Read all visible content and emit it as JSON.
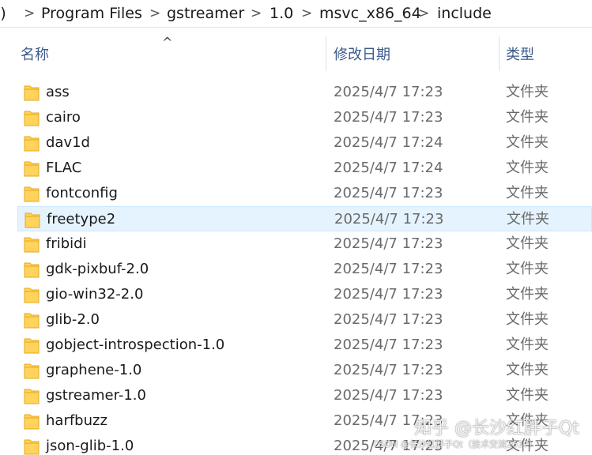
{
  "breadcrumb": {
    "items": [
      ":)",
      "Program Files",
      "gstreamer",
      "1.0",
      "msvc_x86_64",
      "include"
    ],
    "separator": ">"
  },
  "columns": {
    "name": "名称",
    "date": "修改日期",
    "type": "类型",
    "sort_indicator": "^"
  },
  "files": [
    {
      "name": "ass",
      "date": "2025/4/7 17:23",
      "type": "文件夹"
    },
    {
      "name": "cairo",
      "date": "2025/4/7 17:23",
      "type": "文件夹"
    },
    {
      "name": "dav1d",
      "date": "2025/4/7 17:24",
      "type": "文件夹"
    },
    {
      "name": "FLAC",
      "date": "2025/4/7 17:24",
      "type": "文件夹"
    },
    {
      "name": "fontconfig",
      "date": "2025/4/7 17:23",
      "type": "文件夹"
    },
    {
      "name": "freetype2",
      "date": "2025/4/7 17:23",
      "type": "文件夹",
      "selected": true
    },
    {
      "name": "fribidi",
      "date": "2025/4/7 17:23",
      "type": "文件夹"
    },
    {
      "name": "gdk-pixbuf-2.0",
      "date": "2025/4/7 17:23",
      "type": "文件夹"
    },
    {
      "name": "gio-win32-2.0",
      "date": "2025/4/7 17:23",
      "type": "文件夹"
    },
    {
      "name": "glib-2.0",
      "date": "2025/4/7 17:23",
      "type": "文件夹"
    },
    {
      "name": "gobject-introspection-1.0",
      "date": "2025/4/7 17:23",
      "type": "文件夹"
    },
    {
      "name": "graphene-1.0",
      "date": "2025/4/7 17:23",
      "type": "文件夹"
    },
    {
      "name": "gstreamer-1.0",
      "date": "2025/4/7 17:23",
      "type": "文件夹"
    },
    {
      "name": "harfbuzz",
      "date": "2025/4/7 17:23",
      "type": "文件夹"
    },
    {
      "name": "json-glib-1.0",
      "date": "2025/4/7 17:23",
      "type": "文件夹"
    }
  ],
  "watermark": {
    "main": "知乎 @长沙红胖子Qt",
    "sub": "CSDN @长沙红胖子Qt（技术交流2637）"
  },
  "colors": {
    "selected_row_bg": "#e5f3ff",
    "selected_row_border": "#cde8ff",
    "header_text": "#3c5a8c",
    "folder_fill": "#ffd35c",
    "folder_edge": "#e6a817"
  },
  "icons": {
    "folder": "folder-icon",
    "breadcrumb_separator": "chevron-right-icon",
    "sort": "sort-ascending-icon"
  }
}
